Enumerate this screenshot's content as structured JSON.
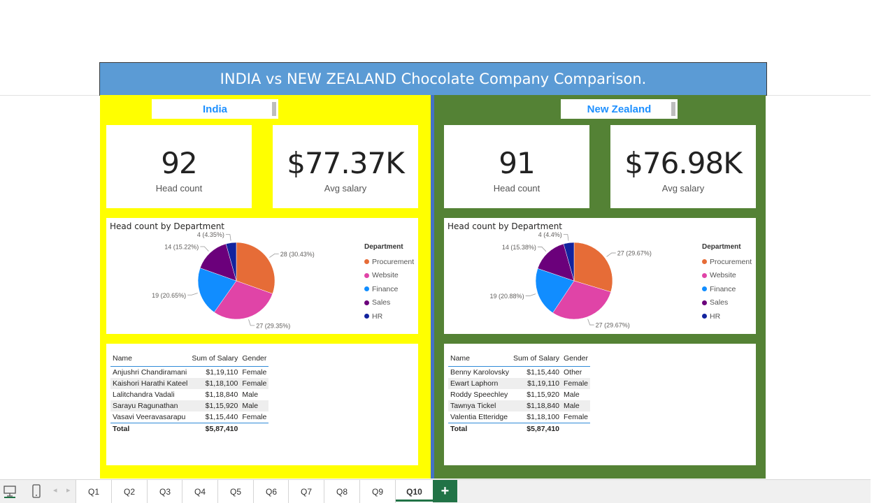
{
  "title": "INDIA vs NEW ZEALAND Chocolate Company Comparison.",
  "colors": {
    "procurement": "#e66c37",
    "website": "#e044a7",
    "finance": "#118dff",
    "sales": "#6b007b",
    "hr": "#12239e"
  },
  "india": {
    "slicer": "India",
    "headcount": "92",
    "headcount_label": "Head count",
    "avg_salary": "$77.37K",
    "avg_salary_label": "Avg salary",
    "chart_title": "Head count by Department",
    "legend_title": "Department",
    "legend": [
      "Procurement",
      "Website",
      "Finance",
      "Sales",
      "HR"
    ],
    "table": {
      "headers": [
        "Name",
        "Sum of Salary",
        "Gender"
      ],
      "rows": [
        [
          "Anjushri Chandiramani",
          "$1,19,110",
          "Female"
        ],
        [
          "Kaishori Harathi Kateel",
          "$1,18,100",
          "Female"
        ],
        [
          "Lalitchandra Vadali",
          "$1,18,840",
          "Male"
        ],
        [
          "Sarayu Ragunathan",
          "$1,15,920",
          "Male"
        ],
        [
          "Vasavi Veeravasarapu",
          "$1,15,440",
          "Female"
        ]
      ],
      "total_label": "Total",
      "total_value": "$5,87,410"
    }
  },
  "nz": {
    "slicer": "New Zealand",
    "headcount": "91",
    "headcount_label": "Head count",
    "avg_salary": "$76.98K",
    "avg_salary_label": "Avg salary",
    "chart_title": "Head count by Department",
    "legend_title": "Department",
    "legend": [
      "Procurement",
      "Website",
      "Finance",
      "Sales",
      "HR"
    ],
    "table": {
      "headers": [
        "Name",
        "Sum of Salary",
        "Gender"
      ],
      "rows": [
        [
          "Benny Karolovsky",
          "$1,15,440",
          "Other"
        ],
        [
          "Ewart Laphorn",
          "$1,19,110",
          "Female"
        ],
        [
          "Roddy Speechley",
          "$1,15,920",
          "Male"
        ],
        [
          "Tawnya Tickel",
          "$1,18,840",
          "Male"
        ],
        [
          "Valentia Etteridge",
          "$1,18,100",
          "Female"
        ]
      ],
      "total_label": "Total",
      "total_value": "$5,87,410"
    }
  },
  "chart_data": [
    {
      "type": "pie",
      "title": "Head count by Department",
      "categories": [
        "Procurement",
        "Website",
        "Finance",
        "Sales",
        "HR"
      ],
      "values": [
        28,
        27,
        19,
        14,
        4
      ],
      "labels": [
        "28 (30.43%)",
        "27 (29.35%)",
        "19 (20.65%)",
        "14 (15.22%)",
        "4 (4.35%)"
      ],
      "legend_position": "right"
    },
    {
      "type": "pie",
      "title": "Head count by Department",
      "categories": [
        "Procurement",
        "Website",
        "Finance",
        "Sales",
        "HR"
      ],
      "values": [
        27,
        27,
        19,
        14,
        4
      ],
      "labels": [
        "27 (29.67%)",
        "27 (29.67%)",
        "19 (20.88%)",
        "14 (15.38%)",
        "4 (4.4%)"
      ],
      "legend_position": "right"
    }
  ],
  "sheet_tabs": [
    "Q1",
    "Q2",
    "Q3",
    "Q4",
    "Q5",
    "Q6",
    "Q7",
    "Q8",
    "Q9",
    "Q10"
  ],
  "active_tab": "Q10",
  "add_tab_label": "+",
  "icons": {
    "desktop": "desktop-icon",
    "mobile": "mobile-icon",
    "prev": "chevron-left-icon",
    "next": "chevron-right-icon"
  }
}
